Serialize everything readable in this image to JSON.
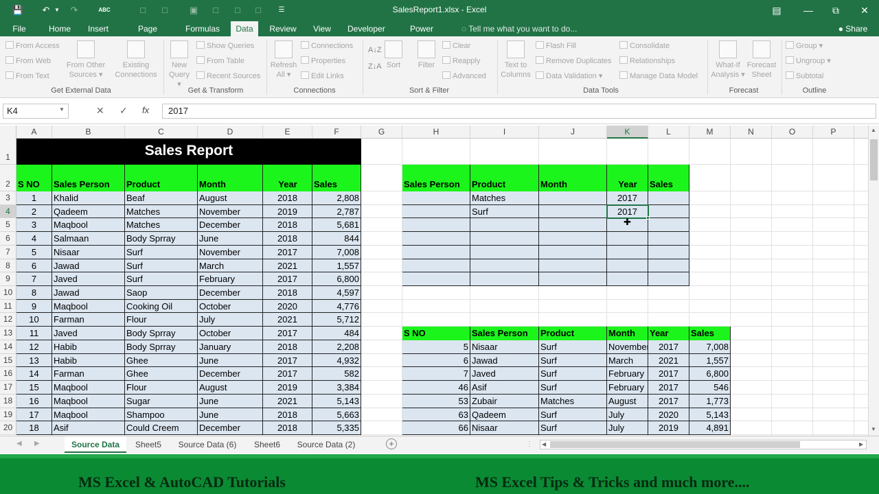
{
  "title": "SalesReport1.xlsx - Excel",
  "tabs": [
    "File",
    "Home",
    "Insert",
    "Page Layout",
    "Formulas",
    "Data",
    "Review",
    "View",
    "Developer",
    "Power Pivot"
  ],
  "tell_me": "Tell me what you want to do...",
  "share": "Share",
  "ribbon": {
    "get_external": {
      "from_access": "From Access",
      "from_web": "From Web",
      "from_text": "From Text",
      "from_other": "From Other",
      "sources": "Sources",
      "existing": "Existing",
      "connections": "Connections",
      "label": "Get External Data"
    },
    "get_transform": {
      "new": "New",
      "query": "Query",
      "show_queries": "Show Queries",
      "from_table": "From Table",
      "recent_sources": "Recent Sources",
      "label": "Get & Transform"
    },
    "connections": {
      "refresh": "Refresh",
      "all": "All",
      "connections": "Connections",
      "properties": "Properties",
      "edit_links": "Edit Links",
      "label": "Connections"
    },
    "sort_filter": {
      "sort": "Sort",
      "filter": "Filter",
      "clear": "Clear",
      "reapply": "Reapply",
      "advanced": "Advanced",
      "label": "Sort & Filter"
    },
    "data_tools": {
      "text_to": "Text to",
      "columns": "Columns",
      "flash_fill": "Flash Fill",
      "remove_duplicates": "Remove Duplicates",
      "data_validation": "Data Validation",
      "consolidate": "Consolidate",
      "relationships": "Relationships",
      "manage_data_model": "Manage Data Model",
      "label": "Data Tools"
    },
    "forecast": {
      "what_if": "What-If",
      "analysis": "Analysis",
      "forecast": "Forecast",
      "sheet": "Sheet",
      "label": "Forecast"
    },
    "outline": {
      "group": "Group",
      "ungroup": "Ungroup",
      "subtotal": "Subtotal",
      "label": "Outline"
    }
  },
  "name_box": "K4",
  "formula": "2017",
  "columns": [
    "A",
    "B",
    "C",
    "D",
    "E",
    "F",
    "G",
    "H",
    "I",
    "J",
    "K",
    "L",
    "M",
    "N",
    "O",
    "P"
  ],
  "rows": [
    "1",
    "2",
    "3",
    "4",
    "5",
    "6",
    "7",
    "8",
    "9",
    "10",
    "11",
    "12",
    "13",
    "14",
    "15",
    "16",
    "17",
    "18",
    "19",
    "20"
  ],
  "report_title": "Sales Report",
  "main_headers": [
    "S NO",
    "Sales Person",
    "Product",
    "Month",
    "Year",
    "Sales"
  ],
  "main_rows": [
    [
      "1",
      "Khalid",
      "Beaf",
      "August",
      "2018",
      "2,808"
    ],
    [
      "2",
      "Qadeem",
      "Matches",
      "November",
      "2019",
      "2,787"
    ],
    [
      "3",
      "Maqbool",
      "Matches",
      "December",
      "2018",
      "5,681"
    ],
    [
      "4",
      "Salmaan",
      "Body Sprray",
      "June",
      "2018",
      "844"
    ],
    [
      "5",
      "Nisaar",
      "Surf",
      "November",
      "2017",
      "7,008"
    ],
    [
      "6",
      "Jawad",
      "Surf",
      "March",
      "2021",
      "1,557"
    ],
    [
      "7",
      "Javed",
      "Surf",
      "February",
      "2017",
      "6,800"
    ],
    [
      "8",
      "Jawad",
      "Saop",
      "December",
      "2018",
      "4,597"
    ],
    [
      "9",
      "Maqbool",
      "Cooking Oil",
      "October",
      "2020",
      "4,776"
    ],
    [
      "10",
      "Farman",
      "Flour",
      "July",
      "2021",
      "5,712"
    ],
    [
      "11",
      "Javed",
      "Body Sprray",
      "October",
      "2017",
      "484"
    ],
    [
      "12",
      "Habib",
      "Body Sprray",
      "January",
      "2018",
      "2,208"
    ],
    [
      "13",
      "Habib",
      "Ghee",
      "June",
      "2017",
      "4,932"
    ],
    [
      "14",
      "Farman",
      "Ghee",
      "December",
      "2017",
      "582"
    ],
    [
      "15",
      "Maqbool",
      "Flour",
      "August",
      "2019",
      "3,384"
    ],
    [
      "16",
      "Maqbool",
      "Sugar",
      "June",
      "2021",
      "5,143"
    ],
    [
      "17",
      "Maqbool",
      "Shampoo",
      "June",
      "2018",
      "5,663"
    ],
    [
      "18",
      "Asif",
      "Could Creem",
      "December",
      "2018",
      "5,335"
    ]
  ],
  "criteria_headers": [
    "Sales Person",
    "Product",
    "Month",
    "Year",
    "Sales"
  ],
  "criteria_rows": [
    [
      "",
      "Matches",
      "",
      "2017",
      ""
    ],
    [
      "",
      "Surf",
      "",
      "2017",
      ""
    ]
  ],
  "result_headers": [
    "S NO",
    "Sales Person",
    "Product",
    "Month",
    "Year",
    "Sales"
  ],
  "result_rows": [
    [
      "5",
      "Nisaar",
      "Surf",
      "November",
      "2017",
      "7,008"
    ],
    [
      "6",
      "Jawad",
      "Surf",
      "March",
      "2021",
      "1,557"
    ],
    [
      "7",
      "Javed",
      "Surf",
      "February",
      "2017",
      "6,800"
    ],
    [
      "46",
      "Asif",
      "Surf",
      "February",
      "2017",
      "546"
    ],
    [
      "53",
      "Zubair",
      "Matches",
      "August",
      "2017",
      "1,773"
    ],
    [
      "63",
      "Qadeem",
      "Surf",
      "July",
      "2020",
      "5,143"
    ],
    [
      "66",
      "Nisaar",
      "Surf",
      "July",
      "2019",
      "4,891"
    ]
  ],
  "sheets": [
    "Source Data",
    "Sheet5",
    "Source Data (6)",
    "Sheet6",
    "Source Data (2)"
  ],
  "banner": {
    "left": "MS Excel & AutoCAD Tutorials",
    "right": "MS Excel Tips & Tricks and much more...."
  }
}
